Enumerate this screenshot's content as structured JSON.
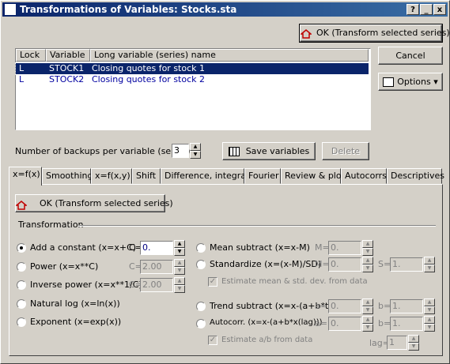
{
  "window": {
    "title": "Transformations of Variables: Stocks.sta"
  },
  "titlebar_buttons": [
    "?",
    "_",
    "x"
  ],
  "buttons": {
    "ok_top": "OK (Transform selected series)",
    "cancel": "Cancel",
    "options": "Options",
    "save_variables": "Save variables",
    "delete": "Delete",
    "ok_panel": "OK (Transform selected series)"
  },
  "list": {
    "columns": [
      "Lock",
      "Variable",
      "Long variable (series) name"
    ],
    "rows": [
      {
        "lock": "L",
        "variable": "STOCK1",
        "name": "Closing quotes for stock 1",
        "selected": true
      },
      {
        "lock": "L",
        "variable": "STOCK2",
        "name": "Closing quotes for stock 2",
        "selected": false
      }
    ]
  },
  "backups": {
    "label": "Number of backups per variable (series):",
    "value": "3"
  },
  "tabs": [
    "x=f(x)",
    "Smoothing",
    "x=f(x,y)",
    "Shift",
    "Difference, integrate",
    "Fourier",
    "Review & plot",
    "Autocorrs",
    "Descriptives"
  ],
  "active_tab": "x=f(x)",
  "transformation": {
    "group_label": "Transformation",
    "left_options": [
      {
        "label": "Add a constant (x=x+C)",
        "param": "C=",
        "value": "0.",
        "checked": true,
        "enabled": true
      },
      {
        "label": "Power (x=x**C)",
        "param": "C=",
        "value": "2.00",
        "checked": false,
        "enabled": false
      },
      {
        "label": "Inverse power (x=x**1/C)",
        "param": "C=",
        "value": "2.00",
        "checked": false,
        "enabled": false
      },
      {
        "label": "Natural log (x=ln(x))",
        "checked": false
      },
      {
        "label": "Exponent (x=exp(x))",
        "checked": false
      }
    ],
    "mean_subtract": {
      "label": "Mean subtract (x=x-M)",
      "param": "M=",
      "value": "0."
    },
    "standardize": {
      "label": "Standardize (x=(x-M)/SD)",
      "m_param": "M=",
      "m_value": "0.",
      "s_param": "S=",
      "s_value": "1."
    },
    "estimate_mean": "Estimate mean & std. dev. from data",
    "trend_subtract": {
      "label": "Trend subtract (x=x-(a+b*t))",
      "a_param": "a=",
      "a_value": "0.",
      "b_param": "b=",
      "b_value": "1."
    },
    "autocorr": {
      "label": "Autocorr. (x=x-(a+b*x(lag)))",
      "a_param": "a=",
      "a_value": "0.",
      "b_param": "b=",
      "b_value": "1."
    },
    "estimate_ab": "Estimate a/b from data",
    "lag": {
      "param": "lag=",
      "value": "1"
    }
  }
}
